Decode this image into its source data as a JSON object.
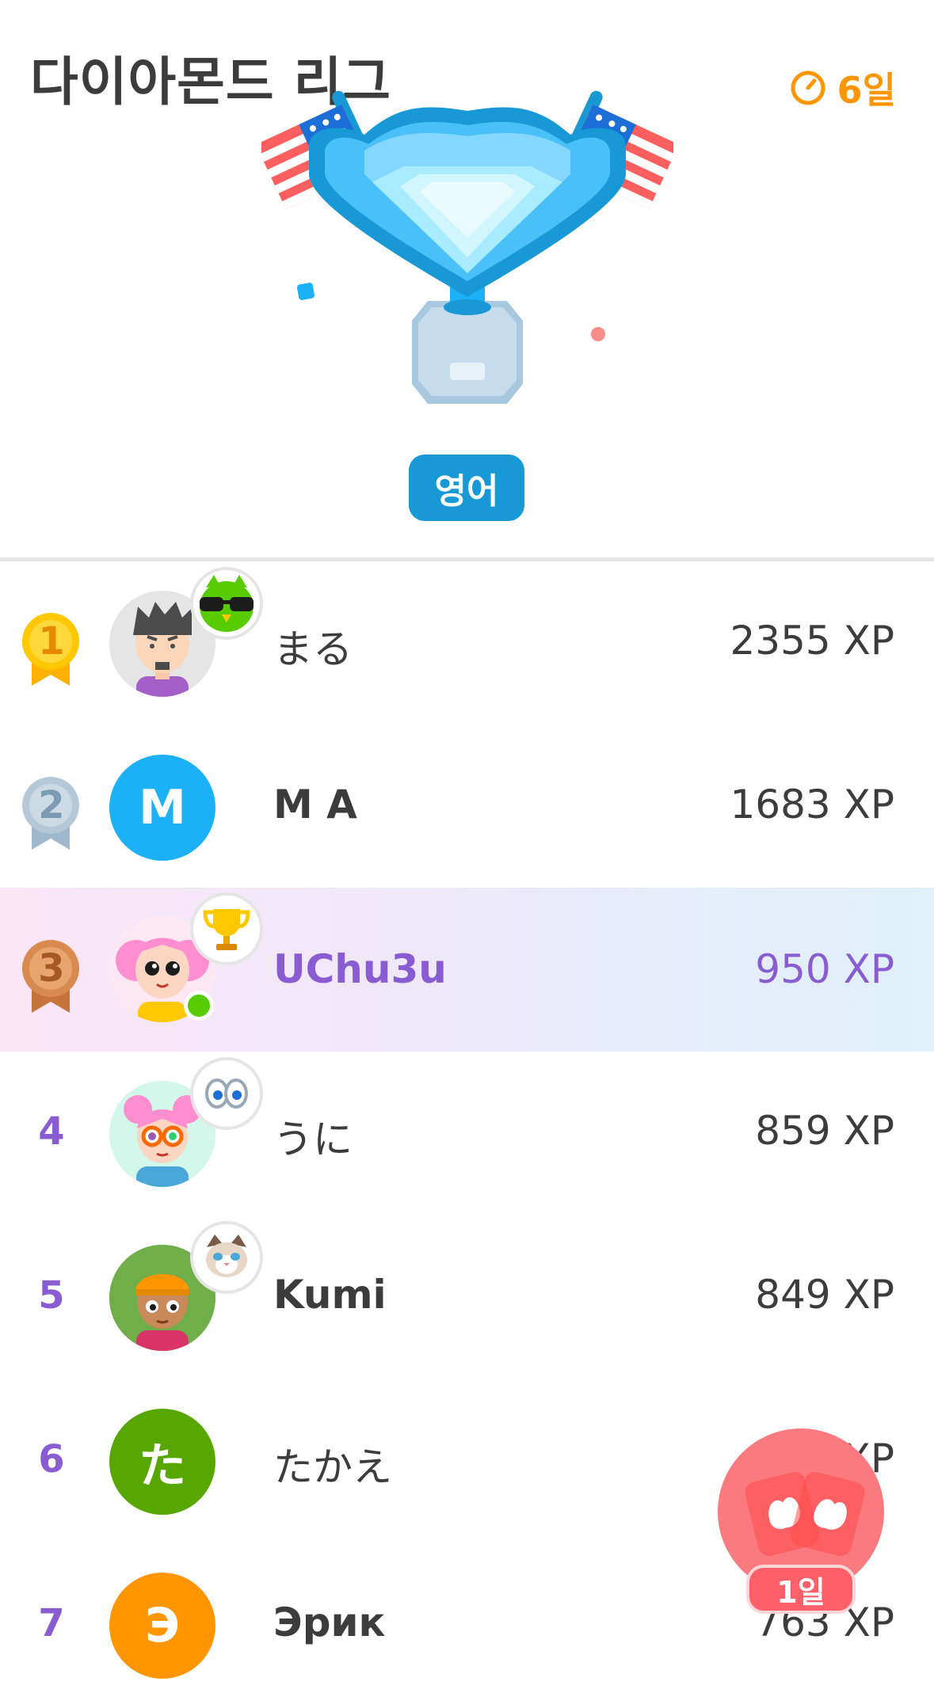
{
  "header": {
    "title": "다이아몬드 리그",
    "timer_label": "6일",
    "language_button": "영어"
  },
  "colors": {
    "accent_orange": "#ff9600",
    "league_blue": "#1899d6",
    "current_user_purple": "#8a5cd1",
    "gold": "#ffc800",
    "silver": "#b4c8d8",
    "bronze": "#d98a4f",
    "fab_red": "#fb7a7f"
  },
  "leaderboard": [
    {
      "rank": "1",
      "medal": "gold-medal-icon",
      "name": "まる",
      "xp": "2355 XP",
      "avatar_type": "illustration",
      "badge_icon": "cool-owl-icon"
    },
    {
      "rank": "2",
      "medal": "silver-medal-icon",
      "name": "M A",
      "xp": "1683 XP",
      "avatar_letter": "M",
      "avatar_color": "#1cb0f6"
    },
    {
      "rank": "3",
      "medal": "bronze-medal-icon",
      "name": "UChu3u",
      "xp": "950 XP",
      "avatar_type": "illustration",
      "badge_icon": "trophy-icon",
      "current_user": true
    },
    {
      "rank": "4",
      "name": "うに",
      "xp": "859 XP",
      "avatar_type": "illustration",
      "badge_icon": "eyes-icon"
    },
    {
      "rank": "5",
      "name": "Kumi",
      "xp": "849 XP",
      "avatar_type": "illustration",
      "badge_icon": "cat-icon"
    },
    {
      "rank": "6",
      "name": "たかえ",
      "xp": "XP",
      "avatar_letter": "た",
      "avatar_color": "#58a700"
    },
    {
      "rank": "7",
      "name": "Эрик",
      "xp": "763 XP",
      "avatar_letter": "Э",
      "avatar_color": "#ff9600"
    }
  ],
  "fab": {
    "icon": "friend-streak-cards-icon",
    "label": "1일"
  }
}
